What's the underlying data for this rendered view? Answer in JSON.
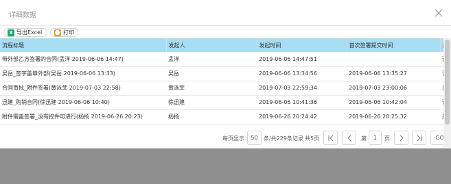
{
  "dialog": {
    "title": "详细数据"
  },
  "toolbar": {
    "export_label": "导出Excel",
    "print_label": "打印"
  },
  "table": {
    "columns": [
      "流程标题",
      "发起人",
      "发起时间",
      "首次签署提交时间",
      "是否"
    ],
    "rows": [
      [
        "带外部乙方签署的合同(孟洋 2019-06-06 14:47)",
        "孟洋",
        "2019-06-06 14:47:51",
        "",
        "否"
      ],
      [
        "吴岳_签字盖章外部(吴岳 2019-06-06 13:33)",
        "吴岳",
        "2019-06-06 13:34:56",
        "2019-06-06 13:35:27",
        "否"
      ],
      [
        "合同审批_附件签署(黄泳菲 2019-07-03 22:58)",
        "黄泳菲",
        "2019-07-03 22:59:34",
        "2019-07-03 23:00:06",
        "是"
      ],
      [
        "迅建_购销合同(徐迅建 2019-06-06 10:40)",
        "徐迅建",
        "2019-06-06 10:41:36",
        "2019-06-06 10:42:04",
        "否"
      ],
      [
        "附件需盖签署_没有控件可进行(杨扬 2019-06-26 20:23)",
        "杨扬",
        "2019-06-26 20:24:42",
        "2019-06-26 20:25:32",
        "是"
      ]
    ]
  },
  "pager": {
    "per_page_label": "每页显示",
    "per_page_value": "50",
    "total_label": "条/共229条记录",
    "pages_label": "共5页",
    "first": "|<",
    "prev": "<",
    "page_prefix": "第",
    "page_value": "1",
    "page_suffix": "页",
    "next": ">",
    "last": ">|",
    "go_label": "GO"
  },
  "colors": {
    "header_bg": "#a8dcf0",
    "excel_green": "#21a366",
    "print_orange": "#f39c12"
  }
}
